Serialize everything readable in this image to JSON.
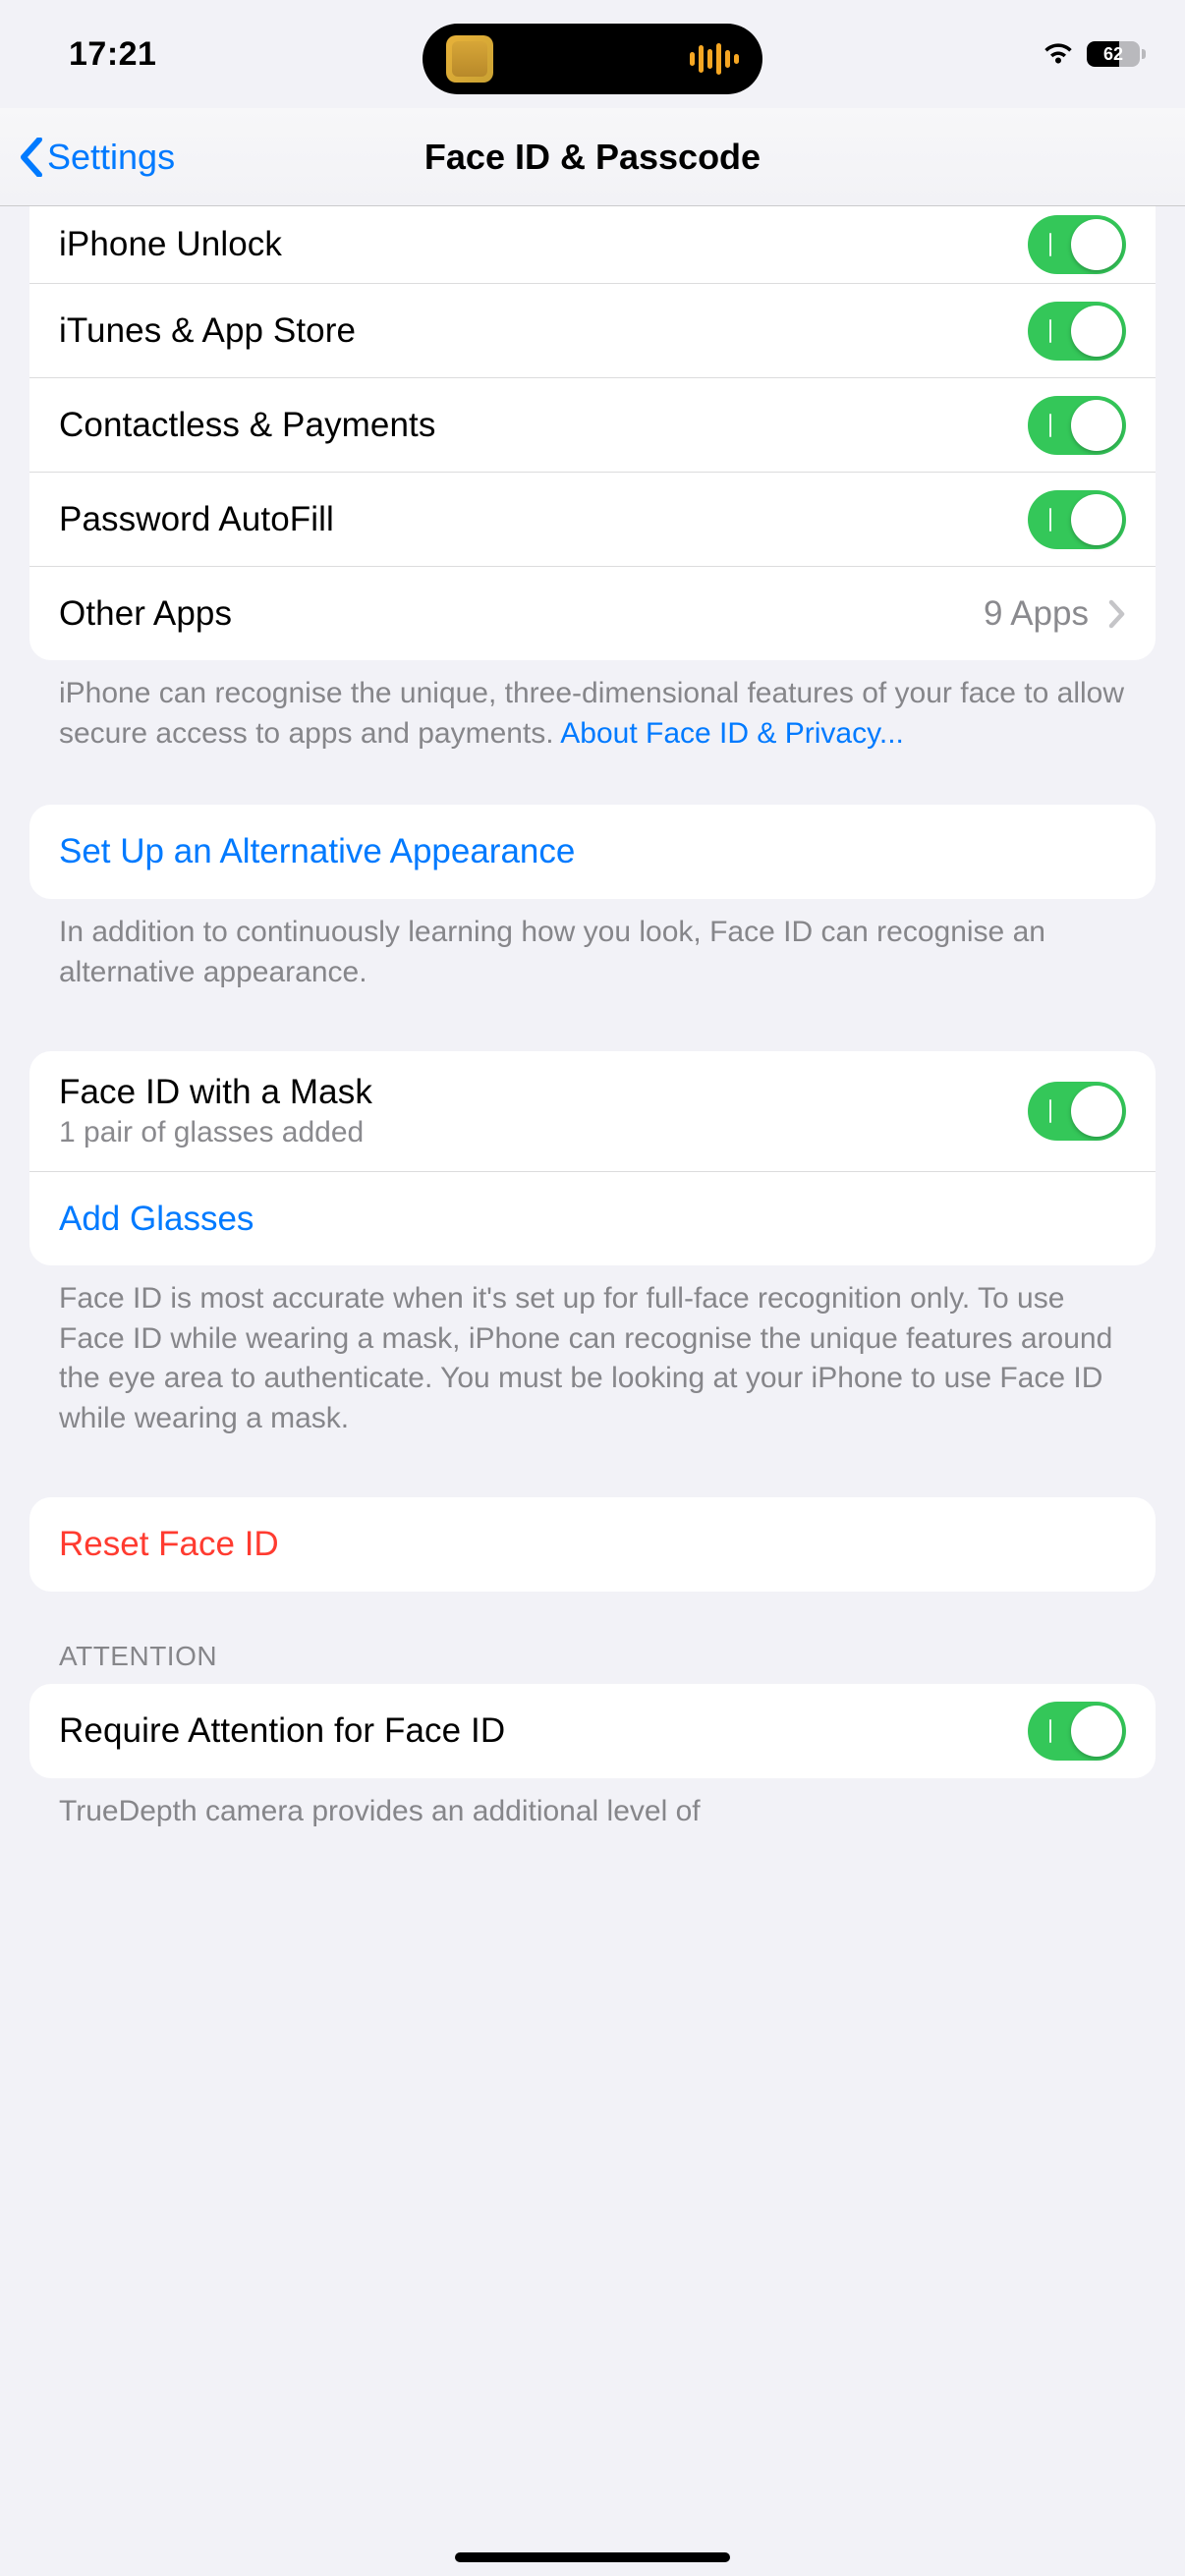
{
  "status": {
    "time": "17:21",
    "battery_pct": 62
  },
  "nav": {
    "back_label": "Settings",
    "title": "Face ID & Passcode"
  },
  "use_faceid": {
    "items": [
      {
        "label": "iPhone Unlock",
        "on": true
      },
      {
        "label": "iTunes & App Store",
        "on": true
      },
      {
        "label": "Contactless & Payments",
        "on": true
      },
      {
        "label": "Password AutoFill",
        "on": true
      }
    ],
    "other_apps_label": "Other Apps",
    "other_apps_value": "9 Apps",
    "footer_text": "iPhone can recognise the unique, three-dimensional features of your face to allow secure access to apps and payments. ",
    "footer_link": "About Face ID & Privacy..."
  },
  "alt_appearance": {
    "button": "Set Up an Alternative Appearance",
    "footer": "In addition to continuously learning how you look, Face ID can recognise an alternative appearance."
  },
  "mask": {
    "label": "Face ID with a Mask",
    "sub": "1 pair of glasses added",
    "on": true,
    "add_glasses": "Add Glasses",
    "footer": "Face ID is most accurate when it's set up for full-face recognition only. To use Face ID while wearing a mask, iPhone can recognise the unique features around the eye area to authenticate. You must be looking at your iPhone to use Face ID while wearing a mask."
  },
  "reset": {
    "label": "Reset Face ID"
  },
  "attention": {
    "header": "ATTENTION",
    "require_label": "Require Attention for Face ID",
    "require_on": true,
    "footer_partial": "TrueDepth camera provides an additional level of"
  }
}
